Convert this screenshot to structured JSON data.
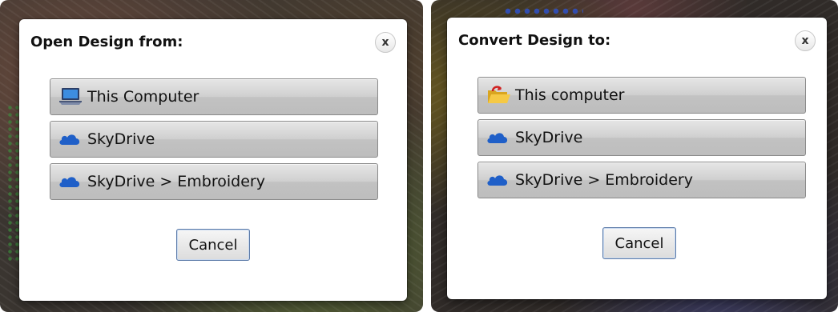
{
  "open_dialog": {
    "title": "Open Design from:",
    "close_label": "x",
    "options": [
      {
        "label": "This Computer",
        "icon": "laptop-icon"
      },
      {
        "label": "SkyDrive",
        "icon": "skydrive-cloud-icon"
      },
      {
        "label": "SkyDrive > Embroidery",
        "icon": "skydrive-cloud-icon"
      }
    ],
    "cancel_label": "Cancel"
  },
  "convert_dialog": {
    "title": "Convert Design to:",
    "close_label": "x",
    "options": [
      {
        "label": "This computer",
        "icon": "folder-open-icon"
      },
      {
        "label": "SkyDrive",
        "icon": "skydrive-cloud-icon"
      },
      {
        "label": "SkyDrive > Embroidery",
        "icon": "skydrive-cloud-icon"
      }
    ],
    "cancel_label": "Cancel"
  },
  "colors": {
    "cloud_blue": "#1f5fc8",
    "button_gray": "#cfcfcf",
    "cancel_border": "#5b7aa8"
  }
}
